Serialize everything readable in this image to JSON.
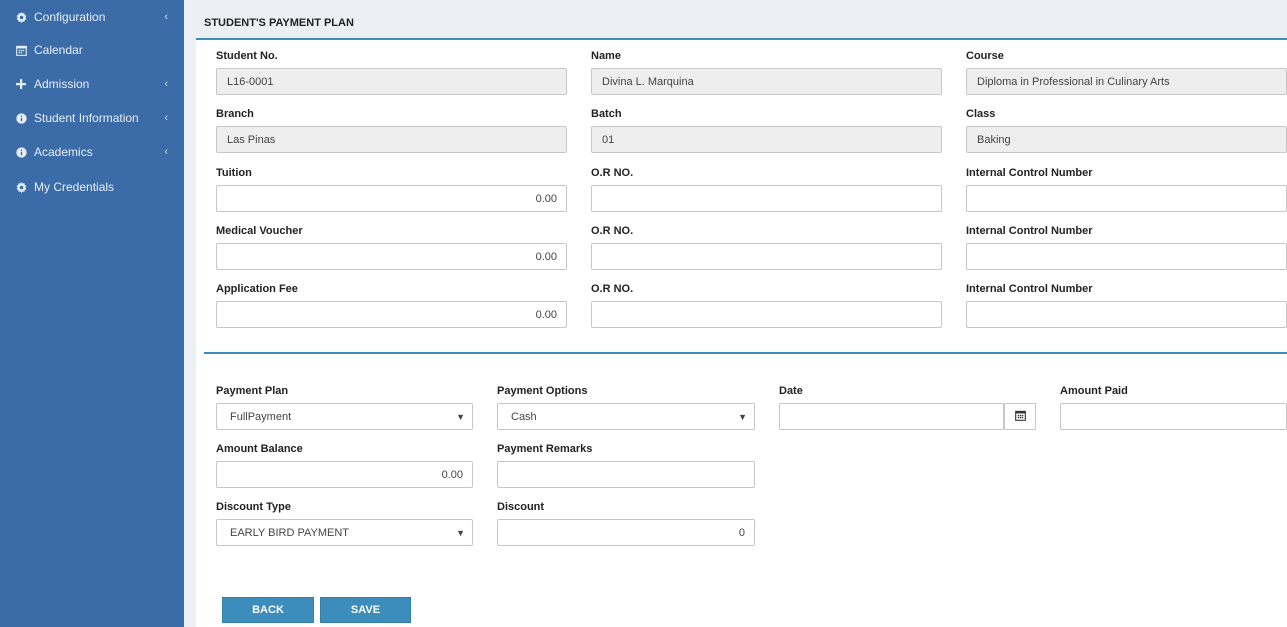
{
  "sidebar": {
    "items": [
      {
        "label": "Configuration",
        "icon": "gear-icon",
        "has_chevron": true
      },
      {
        "label": "Calendar",
        "icon": "calendar-icon",
        "has_chevron": false
      },
      {
        "label": "Admission",
        "icon": "plus-icon",
        "has_chevron": true
      },
      {
        "label": "Student Information",
        "icon": "info-icon",
        "has_chevron": true
      },
      {
        "label": "Academics",
        "icon": "info-icon",
        "has_chevron": true
      },
      {
        "label": "My Credentials",
        "icon": "gear-icon",
        "has_chevron": false
      }
    ],
    "chevron": "‹"
  },
  "page": {
    "title": "STUDENT'S PAYMENT PLAN"
  },
  "student": {
    "student_no": {
      "label": "Student No.",
      "value": "L16-0001"
    },
    "name": {
      "label": "Name",
      "value": "Divina L. Marquina"
    },
    "course": {
      "label": "Course",
      "value": "Diploma in Professional in Culinary Arts"
    },
    "branch": {
      "label": "Branch",
      "value": "Las Pinas"
    },
    "batch": {
      "label": "Batch",
      "value": "01"
    },
    "class": {
      "label": "Class",
      "value": "Baking"
    }
  },
  "fees": {
    "tuition": {
      "label": "Tuition",
      "value": "0.00"
    },
    "medical_voucher": {
      "label": "Medical Voucher",
      "value": "0.00"
    },
    "application_fee": {
      "label": "Application Fee",
      "value": "0.00"
    },
    "or_label": "O.R NO.",
    "icn_label": "Internal Control Number"
  },
  "payment": {
    "plan": {
      "label": "Payment Plan",
      "value": "FullPayment"
    },
    "options": {
      "label": "Payment Options",
      "value": "Cash"
    },
    "date": {
      "label": "Date",
      "value": ""
    },
    "amount_paid": {
      "label": "Amount Paid",
      "value": ""
    },
    "amount_balance": {
      "label": "Amount Balance",
      "value": "0.00"
    },
    "remarks": {
      "label": "Payment Remarks",
      "value": ""
    },
    "discount_type": {
      "label": "Discount Type",
      "value": "EARLY BIRD PAYMENT"
    },
    "discount": {
      "label": "Discount",
      "value": "0"
    },
    "caret": "▼"
  },
  "buttons": {
    "back": "BACK",
    "save": "SAVE"
  },
  "colors": {
    "sidebar": "#3c6ca8",
    "accent": "#3c8dbc",
    "readonly_bg": "#eeeeee"
  }
}
